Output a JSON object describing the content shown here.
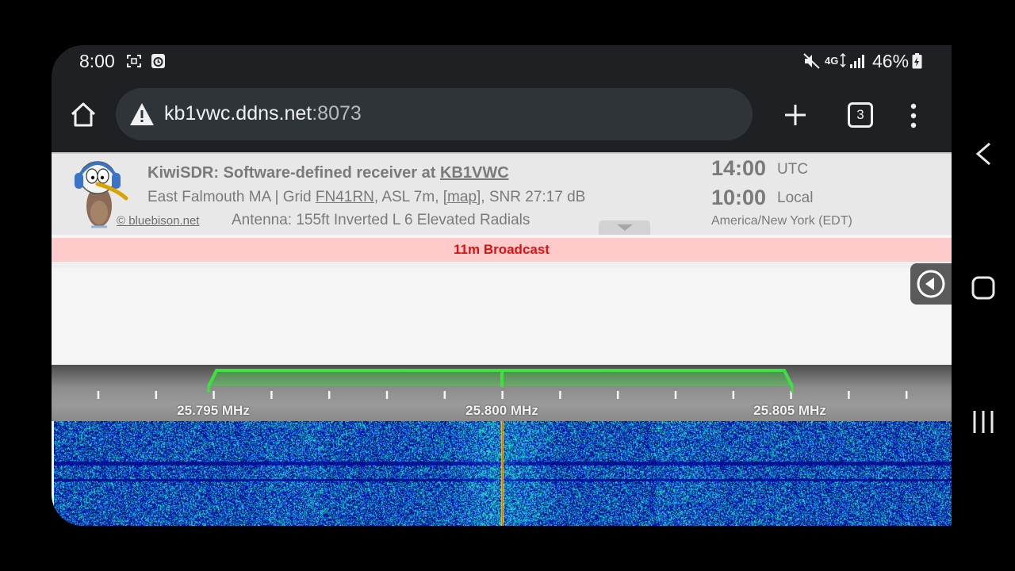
{
  "status_bar": {
    "time": "8:00",
    "battery": "46%",
    "icons": [
      "screenshot-icon",
      "alarm-icon",
      "mute-icon",
      "network-5g-icon",
      "signal-icon",
      "battery-charging-icon"
    ]
  },
  "browser": {
    "url_host": "kb1vwc.ddns.net",
    "url_port": ":8073",
    "tab_count": "3",
    "icons": [
      "home-icon",
      "warning-icon",
      "plus-icon",
      "more-vert-icon"
    ]
  },
  "receiver": {
    "title_prefix": "KiwiSDR: Software-defined receiver at ",
    "callsign": "KB1VWC",
    "loc_part1": "East Falmouth MA | Grid ",
    "grid": "FN41RN",
    "loc_part2": ", ASL 7m, ",
    "map_link": "[map]",
    "loc_part3": ", SNR 27:17 dB",
    "antenna": "Antenna: 155ft Inverted L 6 Elevated Radials",
    "logo_credit": "© bluebison.net",
    "utc_time": "14:00",
    "utc_label": "UTC",
    "local_time": "10:00",
    "local_label": "Local",
    "timezone": "America/New York (EDT)"
  },
  "band": {
    "label": "11m Broadcast",
    "color": "#e01010",
    "background": "#ffcaca"
  },
  "scale": {
    "labels": [
      "25.795 MHz",
      "25.800 MHz",
      "25.805 MHz"
    ],
    "passband_color": "#3ee23e"
  },
  "android_nav": [
    "back-icon",
    "home-icon",
    "recents-icon"
  ]
}
